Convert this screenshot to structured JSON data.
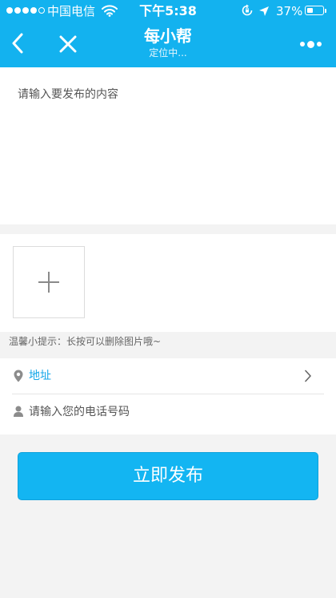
{
  "status_bar": {
    "carrier": "中国电信",
    "time": "下午5:38",
    "battery_percent": "37%",
    "battery_level": 0.37,
    "signal_bars_filled": 4,
    "signal_bars_total": 5
  },
  "nav": {
    "title": "每小帮",
    "subtitle": "定位中...",
    "icons": {
      "back": "chevron-left-icon",
      "close": "close-icon",
      "more": "more-icon"
    }
  },
  "content": {
    "placeholder": "请输入要发布的内容",
    "value": ""
  },
  "images": {
    "add_icon": "plus-icon",
    "tip": "温馨小提示：长按可以删除图片哦~"
  },
  "address": {
    "label": "地址",
    "icon": "map-pin-icon"
  },
  "phone": {
    "placeholder": "请输入您的电话号码",
    "value": "",
    "icon": "person-icon"
  },
  "publish": {
    "label": "立即发布"
  },
  "colors": {
    "brand": "#13b2ef",
    "link": "#13a6e8",
    "background": "#f3f3f3"
  }
}
